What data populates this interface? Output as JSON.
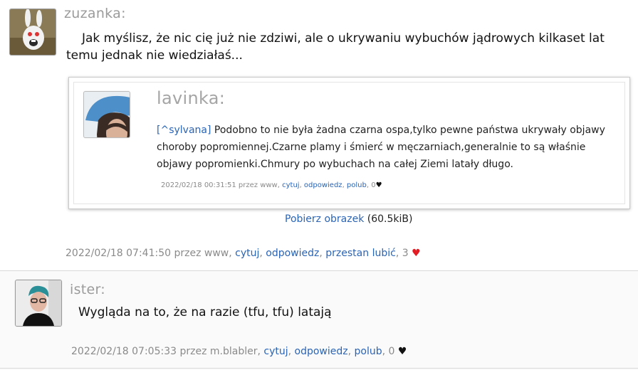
{
  "comments": [
    {
      "username": "zuzanka:",
      "text": "Jak myślisz, że nic cię już nie zdziwi, ale o ukrywaniu wybuchów jądrowych kilkaset lat temu jednak nie wiedziałaś...",
      "embedded": {
        "username": "lavinka:",
        "mention": "[^sylvana]",
        "text": "Podobno to nie była żadna czarna ospa,tylko pewne państwa ukrywały objawy choroby popromiennej.Czarne plamy i śmierć w męczarniach,generalnie to są właśnie objawy popromienki.Chmury po wybuchach na całej Ziemi latały długo.",
        "meta": "2022/02/18 00:31:51 przez www,",
        "links": [
          "cytuj",
          "odpowiedz",
          "polub"
        ],
        "likes": "0"
      },
      "download_label": "Pobierz obrazek",
      "download_size": "(60.5kiB)",
      "meta": "2022/02/18 07:41:50 przez www,",
      "links": [
        "cytuj",
        "odpowiedz",
        "przestan lubić"
      ],
      "likes": "3"
    },
    {
      "username": "ister:",
      "text": "Wygląda na to, że na razie (tfu, tfu) latają",
      "meta": "2022/02/18 07:05:33 przez m.blabler,",
      "links": [
        "cytuj",
        "odpowiedz",
        "polub"
      ],
      "likes": "0"
    }
  ],
  "icons": {
    "heart_liked": "heart-filled-red",
    "heart": "heart-filled-black"
  },
  "colors": {
    "link": "#2a64b5",
    "username": "#9b9b9b",
    "meta": "#8a8a8a",
    "heart_liked": "#e31b23"
  }
}
